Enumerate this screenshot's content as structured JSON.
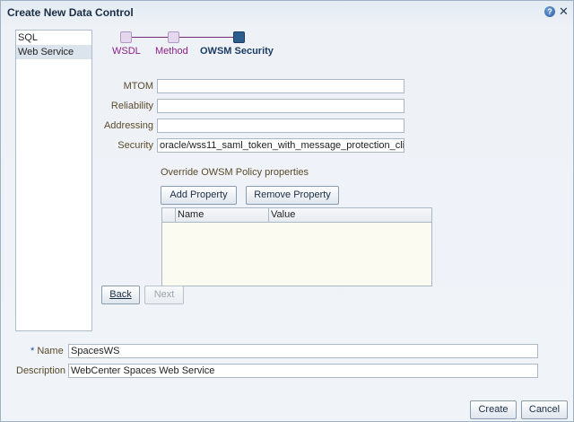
{
  "dialog": {
    "title": "Create New Data Control",
    "help_glyph": "?",
    "close_glyph": "✕"
  },
  "left_list": {
    "items": [
      {
        "label": "SQL",
        "selected": false
      },
      {
        "label": "Web Service",
        "selected": true
      }
    ]
  },
  "train": {
    "steps": [
      {
        "label": "WSDL",
        "state": "visited"
      },
      {
        "label": "Method",
        "state": "visited"
      },
      {
        "label": "OWSM Security",
        "state": "current"
      }
    ]
  },
  "form": {
    "mtom": {
      "label": "MTOM",
      "value": ""
    },
    "reliability": {
      "label": "Reliability",
      "value": ""
    },
    "addressing": {
      "label": "Addressing",
      "value": ""
    },
    "security": {
      "label": "Security",
      "value": "oracle/wss11_saml_token_with_message_protection_cli"
    }
  },
  "override": {
    "label": "Override OWSM Policy properties",
    "add_button": "Add Property",
    "remove_button": "Remove Property",
    "table": {
      "columns": [
        "Name",
        "Value"
      ],
      "rows": []
    }
  },
  "nav": {
    "back": "Back",
    "next": "Next"
  },
  "bottom": {
    "name_required_mark": "*",
    "name_label": "Name",
    "name_value": "SpacesWS",
    "description_label": "Description",
    "description_value": "WebCenter Spaces Web Service"
  },
  "footer": {
    "create": "Create",
    "cancel": "Cancel"
  },
  "colors": {
    "visited_step": "#8a1f8a",
    "current_step": "#2d5d8c",
    "label_text": "#5a4a2a"
  }
}
